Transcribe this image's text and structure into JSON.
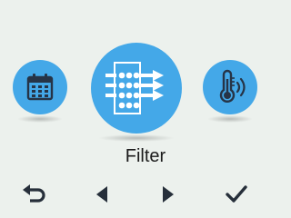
{
  "colors": {
    "background": "#ecf1ed",
    "accent": "#44a8e8",
    "icon": "#ffffff",
    "nav": "#262f3a"
  },
  "carousel": {
    "left_icon": "calendar-icon",
    "center_icon": "filter-icon",
    "right_icon": "thermometer-icon",
    "selected_label": "Filter"
  },
  "nav": {
    "back_icon": "back-arrow-icon",
    "prev_icon": "chevron-left-icon",
    "next_icon": "chevron-right-icon",
    "confirm_icon": "checkmark-icon"
  }
}
